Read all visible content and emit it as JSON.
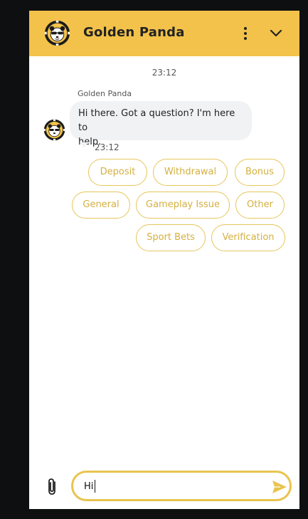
{
  "header": {
    "title": "Golden Panda",
    "menu_icon": "more-vertical-icon",
    "collapse_icon": "chevron-down-icon",
    "brand_color": "#f2c24a"
  },
  "chat": {
    "date_time": "23:12",
    "sender_name": "Golden Panda",
    "message_line1": "Hi there. Got a question? I'm here to",
    "message_line2": "help.",
    "message_time": "23:12"
  },
  "quick_replies": [
    "Deposit",
    "Withdrawal",
    "Bonus",
    "General",
    "Gameplay Issue",
    "Other",
    "Sport Bets",
    "Verification"
  ],
  "composer": {
    "value": "Hi",
    "attach_icon": "paperclip-icon",
    "send_icon": "send-icon",
    "accent_color": "#e8c44f"
  }
}
